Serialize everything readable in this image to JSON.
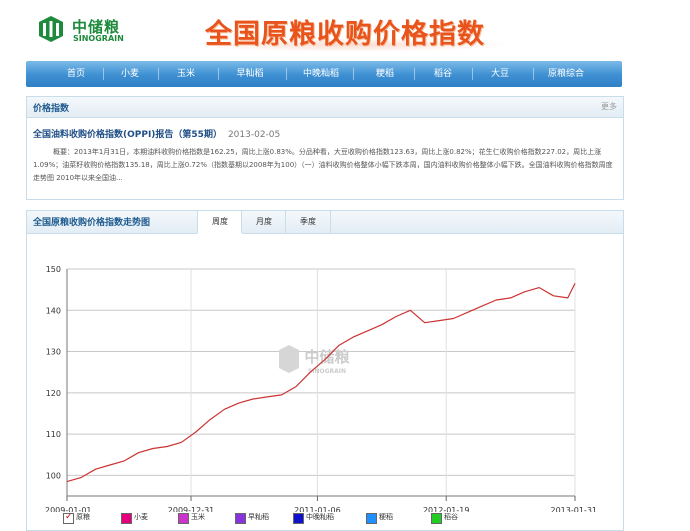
{
  "header": {
    "logo_cn": "中储粮",
    "logo_en": "SINOGRAIN",
    "banner_title": "全国原粮收购价格指数"
  },
  "nav": {
    "items": [
      "首页",
      "小麦",
      "玉米",
      "早籼稻",
      "中晚籼稻",
      "粳稻",
      "稻谷",
      "大豆",
      "原粮综合"
    ]
  },
  "news_panel": {
    "title": "价格指数",
    "more": "更多",
    "article_title": "全国油料收购价格指数(OPPI)报告（第55期）",
    "article_date": "2013-02-05",
    "article_summary": "概要：2013年1月31日，本期油料收购价格指数是162.25，周比上涨0.83%。分品种看，大豆收购价格指数123.63，周比上涨0.82%；花生仁收购价格指数227.02，周比上涨1.09%；油菜籽收购价格指数135.18，周比上涨0.72%（指数基期以2008年为100）（一）油料收购价格整体小幅下跌本周，国内油料收购价格整体小幅下跌。全国油料收购价格指数周度走势图 2010年以来全国油..."
  },
  "chart_panel": {
    "title": "全国原粮收购价格指数走势图",
    "tabs": [
      "周度",
      "月度",
      "季度"
    ],
    "active_tab": "周度",
    "watermark_cn": "中储粮",
    "watermark_en": "SINOGRAIN"
  },
  "legend": [
    {
      "label": "原粮",
      "color": "#cc0000",
      "checked": true
    },
    {
      "label": "小麦",
      "color": "#e6007e",
      "checked": false
    },
    {
      "label": "玉米",
      "color": "#cc33cc",
      "checked": false
    },
    {
      "label": "早籼稻",
      "color": "#8833dd",
      "checked": false
    },
    {
      "label": "中晚籼稻",
      "color": "#1111cc",
      "checked": false
    },
    {
      "label": "粳稻",
      "color": "#1e90ff",
      "checked": false
    },
    {
      "label": "稻谷",
      "color": "#22cc22",
      "checked": false
    }
  ],
  "chart_data": {
    "type": "line",
    "title": "全国原粮收购价格指数走势图",
    "xlabel": "",
    "ylabel": "",
    "x_ticks": [
      "2009-01-01",
      "2009-12-31",
      "2011-01-06",
      "2012-01-19",
      "2013-01-31"
    ],
    "y_ticks": [
      100,
      110,
      120,
      130,
      140,
      150
    ],
    "ylim": [
      95,
      150
    ],
    "grid": true,
    "series": [
      {
        "name": "原粮",
        "color": "#cc3333",
        "x": [
          "2009-01-01",
          "2009-02-12",
          "2009-03-26",
          "2009-05-07",
          "2009-06-18",
          "2009-07-30",
          "2009-09-10",
          "2009-10-22",
          "2009-12-03",
          "2010-01-14",
          "2010-02-25",
          "2010-04-08",
          "2010-05-20",
          "2010-07-01",
          "2010-08-12",
          "2010-09-23",
          "2010-11-04",
          "2010-12-16",
          "2011-01-27",
          "2011-03-10",
          "2011-04-21",
          "2011-06-02",
          "2011-07-14",
          "2011-08-25",
          "2011-10-06",
          "2011-11-17",
          "2011-12-29",
          "2012-02-09",
          "2012-03-22",
          "2012-05-03",
          "2012-06-14",
          "2012-07-26",
          "2012-09-06",
          "2012-10-18",
          "2012-11-29",
          "2013-01-10",
          "2013-01-31"
        ],
        "values": [
          98.5,
          99.5,
          101.5,
          102.5,
          103.5,
          105.5,
          106.5,
          107.0,
          108.0,
          110.5,
          113.5,
          116.0,
          117.5,
          118.5,
          119.0,
          119.5,
          121.5,
          125.0,
          128.0,
          131.5,
          133.5,
          135.0,
          136.5,
          138.5,
          140.0,
          137.0,
          137.5,
          138.0,
          139.5,
          141.0,
          142.5,
          143.0,
          144.5,
          145.5,
          143.5,
          143.0,
          146.5
        ]
      }
    ]
  }
}
